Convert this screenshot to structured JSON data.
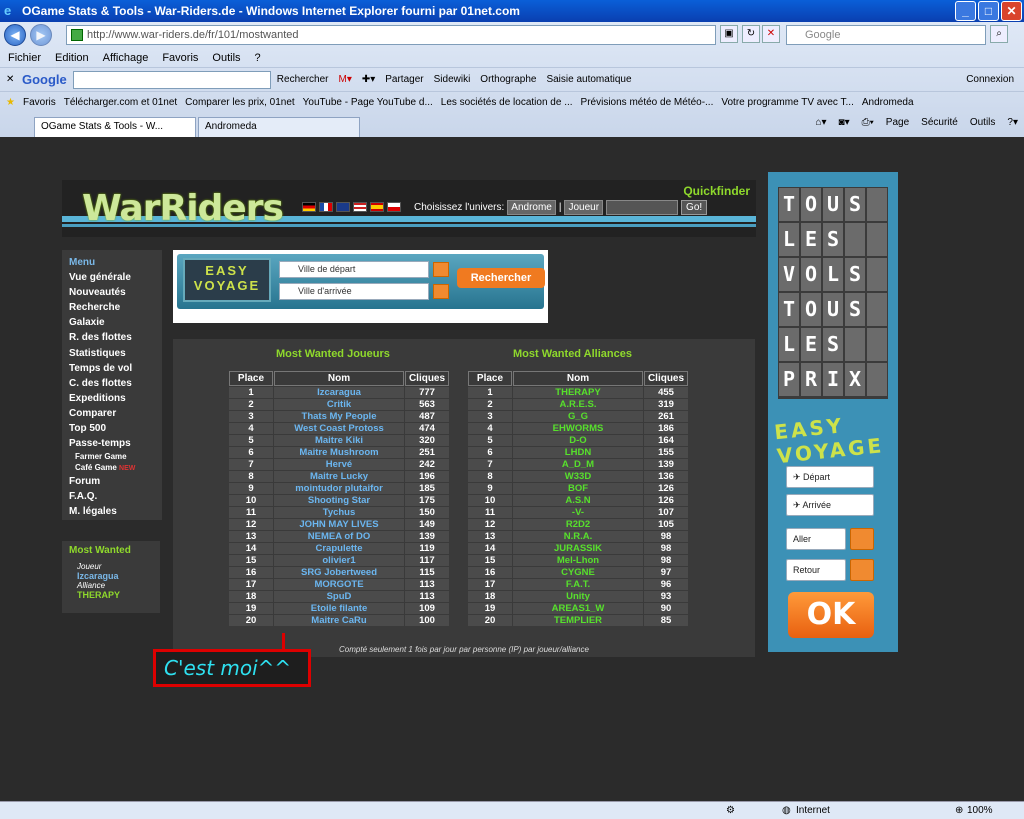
{
  "window": {
    "title": "OGame Stats & Tools - War-Riders.de - Windows Internet Explorer fourni par 01net.com"
  },
  "browser": {
    "url": "http://www.war-riders.de/fr/101/mostwanted",
    "search_placeholder": "Google",
    "menu": [
      "Fichier",
      "Edition",
      "Affichage",
      "Favoris",
      "Outils",
      "?"
    ],
    "google_bar": {
      "logo": "Google",
      "search": "Rechercher",
      "share": "Partager",
      "sidewiki": "Sidewiki",
      "spelling": "Orthographe",
      "autofill": "Saisie automatique",
      "signin": "Connexion"
    },
    "favorites_label": "Favoris",
    "favorites": [
      "Télécharger.com et 01net",
      "Comparer les prix, 01net",
      "YouTube - Page YouTube d...",
      "Les sociétés de location de ...",
      "Prévisions météo de Météo-...",
      "Votre programme TV avec T...",
      "Andromeda"
    ],
    "tabs": [
      "OGame Stats & Tools - W...",
      "Andromeda"
    ],
    "tab_tools": [
      "Page",
      "Sécurité",
      "Outils"
    ]
  },
  "site": {
    "logo": "WarRiders",
    "quickfinder": "Quickfinder",
    "universe_label": "Choisissez l'univers:",
    "universe_value": "Androme",
    "type_value": "Joueur",
    "go": "Go!"
  },
  "left_menu": {
    "title": "Menu",
    "items": [
      "Vue générale",
      "Nouveautés",
      "Recherche",
      "Galaxie",
      "R. des flottes",
      "Statistiques",
      "Temps de vol",
      "C. des flottes",
      "Expeditions",
      "Comparer",
      "Top 500",
      "Passe-temps"
    ],
    "sub_items": [
      "Farmer Game",
      "Café Game"
    ],
    "new_badge": "NEW",
    "items2": [
      "Forum",
      "F.A.Q.",
      "M. légales"
    ]
  },
  "most_wanted_box": {
    "title": "Most Wanted",
    "player_label": "Joueur",
    "player": "Izcaragua",
    "alliance_label": "Alliance",
    "alliance": "THERAPY"
  },
  "ad": {
    "brand_line1": "EASY",
    "brand_line2": "VOYAGE",
    "from": "Ville de départ",
    "to": "Ville d'arrivée",
    "search": "Rechercher"
  },
  "players_title": "Most Wanted Joueurs",
  "alliances_title": "Most Wanted Alliances",
  "columns": {
    "place": "Place",
    "name": "Nom",
    "clicks": "Cliques"
  },
  "players": [
    [
      "1",
      "Izcaragua",
      "777"
    ],
    [
      "2",
      "Critik",
      "563"
    ],
    [
      "3",
      "Thats My People",
      "487"
    ],
    [
      "4",
      "West Coast Protoss",
      "474"
    ],
    [
      "5",
      "Maitre Kiki",
      "320"
    ],
    [
      "6",
      "Maitre Mushroom",
      "251"
    ],
    [
      "7",
      "Hervé",
      "242"
    ],
    [
      "8",
      "Maitre Lucky",
      "196"
    ],
    [
      "9",
      "mointudor plutaifor",
      "185"
    ],
    [
      "10",
      "Shooting Star",
      "175"
    ],
    [
      "11",
      "Tychus",
      "150"
    ],
    [
      "12",
      "JOHN MAY LIVES",
      "149"
    ],
    [
      "13",
      "NEMEA of DO",
      "139"
    ],
    [
      "14",
      "Crapulette",
      "119"
    ],
    [
      "15",
      "olivier1",
      "117"
    ],
    [
      "16",
      "SRG Jobertweed",
      "115"
    ],
    [
      "17",
      "MORGOTE",
      "113"
    ],
    [
      "18",
      "SpuD",
      "113"
    ],
    [
      "19",
      "Etoile filante",
      "109"
    ],
    [
      "20",
      "Maitre CaRu",
      "100"
    ]
  ],
  "alliances": [
    [
      "1",
      "THERAPY",
      "455"
    ],
    [
      "2",
      "A.R.E.S.",
      "319"
    ],
    [
      "3",
      "G_G",
      "261"
    ],
    [
      "4",
      "EHWORMS",
      "186"
    ],
    [
      "5",
      "D-O",
      "164"
    ],
    [
      "6",
      "LHDN",
      "155"
    ],
    [
      "7",
      "A_D_M",
      "139"
    ],
    [
      "8",
      "W33D",
      "136"
    ],
    [
      "9",
      "BOF",
      "126"
    ],
    [
      "10",
      "A.S.N",
      "126"
    ],
    [
      "11",
      "-V-",
      "107"
    ],
    [
      "12",
      "R2D2",
      "105"
    ],
    [
      "13",
      "N.R.A.",
      "98"
    ],
    [
      "14",
      "JURASSIK",
      "98"
    ],
    [
      "15",
      "Mel-Lhon",
      "98"
    ],
    [
      "16",
      "CYGNE",
      "97"
    ],
    [
      "17",
      "F.A.T.",
      "96"
    ],
    [
      "18",
      "Unity",
      "93"
    ],
    [
      "19",
      "AREAS1_W",
      "90"
    ],
    [
      "20",
      "TEMPLIER",
      "85"
    ]
  ],
  "footnote": "Compté seulement 1 fois par jour par personne (IP) par joueur/alliance",
  "callout": "C'est moi^^",
  "right_ad": {
    "wall": [
      [
        "T",
        "O",
        "U",
        "S",
        ""
      ],
      [
        "L",
        "E",
        "S",
        "",
        ""
      ],
      [
        "V",
        "O",
        "L",
        "S",
        ""
      ],
      [
        "T",
        "O",
        "U",
        "S",
        ""
      ],
      [
        "L",
        "E",
        "S",
        "",
        ""
      ],
      [
        "P",
        "R",
        "I",
        "X",
        ""
      ]
    ],
    "brand_line1": "EASY",
    "brand_line2": "VOYAGE",
    "depart": "Départ",
    "arrivee": "Arrivée",
    "aller": "Aller",
    "retour": "Retour",
    "ok": "OK"
  },
  "status": {
    "zone": "Internet",
    "zoom": "100%"
  }
}
